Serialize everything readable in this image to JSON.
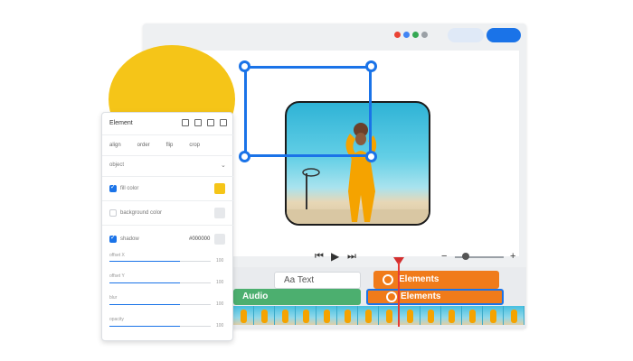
{
  "window": {
    "dots": [
      "#ea4335",
      "#4285f4",
      "#34a853",
      "#9aa0a6"
    ]
  },
  "panel": {
    "title": "Element",
    "tabs": [
      "align",
      "order",
      "flip",
      "crop"
    ],
    "section": "object",
    "fill_color": {
      "label": "fill color",
      "checked": true,
      "color": "#f5c518"
    },
    "background_color": {
      "label": "background color",
      "checked": false,
      "color": "#e6e8eb"
    },
    "shadow": {
      "label": "shadow",
      "checked": true,
      "value": "#000000",
      "color": "#e6e8eb"
    },
    "sliders": [
      {
        "label": "offset X",
        "value": "100"
      },
      {
        "label": "offset Y",
        "value": "100"
      },
      {
        "label": "blur",
        "value": "100"
      },
      {
        "label": "opacity",
        "value": "100"
      }
    ]
  },
  "controls": {
    "rewind": "⏮",
    "play": "▶",
    "forward": "⏭",
    "zoom_out": "−",
    "zoom_in": "+"
  },
  "timeline": {
    "text_track": "Aa Text",
    "elements_track_1": "Elements",
    "audio_track": "Audio",
    "elements_track_2": "Elements"
  }
}
